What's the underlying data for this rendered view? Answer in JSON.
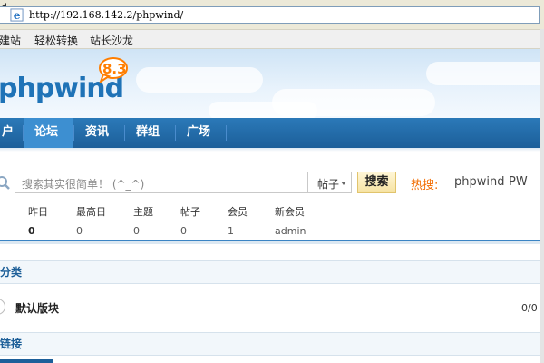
{
  "browser": {
    "url": "http://192.168.142.2/phpwind/"
  },
  "links_bar": {
    "items": [
      "建站",
      "轻松转换",
      "站长沙龙"
    ]
  },
  "header": {
    "logo_text": "phpwind",
    "logo_version": "8.3"
  },
  "nav": {
    "items": [
      {
        "label": "户",
        "active": false
      },
      {
        "label": "论坛",
        "active": true
      },
      {
        "label": "资讯",
        "active": false
      },
      {
        "label": "群组",
        "active": false
      },
      {
        "label": "广场",
        "active": false
      }
    ]
  },
  "search": {
    "placeholder": "搜索其实很简单！ (^_^)",
    "type_label": "帖子",
    "button_label": "搜索",
    "hot_label": "热搜:",
    "hot_links": [
      "phpwind",
      "PW"
    ]
  },
  "stats": [
    {
      "label": "昨日",
      "value": "0"
    },
    {
      "label": "最高日",
      "value": "0"
    },
    {
      "label": "主题",
      "value": "0"
    },
    {
      "label": "帖子",
      "value": "0"
    },
    {
      "label": "会员",
      "value": "1"
    },
    {
      "label": "新会员",
      "value": "admin"
    }
  ],
  "sections": {
    "category_title": "分类",
    "links_title": "链接"
  },
  "forum": {
    "name": "默认版块",
    "count": "0/0"
  },
  "colors": {
    "nav_bg": "#1c5f9a",
    "nav_active": "#3d8fd1",
    "logo_blue": "#1f73b7",
    "logo_orange": "#ff7e00",
    "hot_orange": "#f26c00"
  }
}
